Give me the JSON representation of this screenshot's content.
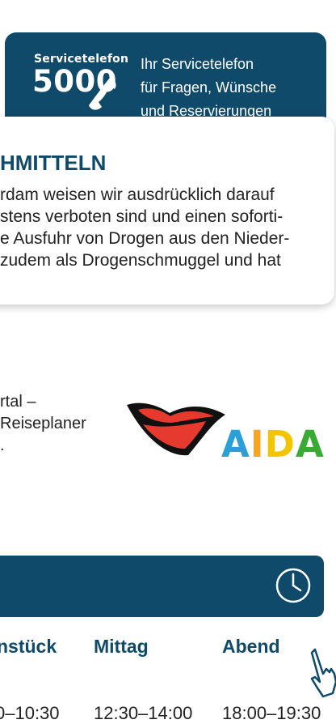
{
  "service_banner": {
    "label": "Servicetelefon",
    "number": "5000",
    "text_lines": [
      "Ihr Servicetelefon",
      "für Fragen, Wünsche",
      "und Reservierungen"
    ]
  },
  "notice": {
    "title": "HMITTELN",
    "lines": [
      "rdam weisen wir ausdrücklich darauf",
      "stens verboten sind und einen soforti-",
      "e Ausfuhr von Drogen aus den Nieder-",
      "zudem als Drogenschmuggel und hat"
    ]
  },
  "portal": {
    "lines": [
      "rtal –",
      "Reiseplaner",
      "."
    ]
  },
  "aida": {
    "letters": [
      "A",
      "I",
      "D",
      "A"
    ],
    "colors": [
      "#2a9fd8",
      "#f5a623",
      "#f2c500",
      "#3aaa35"
    ]
  },
  "meals": {
    "headings": [
      "nstück",
      "Mittag",
      "Abend"
    ],
    "times": [
      "0–10:30",
      "12:30–14:00",
      "18:00–19:30"
    ]
  },
  "colors": {
    "brand_blue": "#0f4a6b",
    "lips_red": "#e63a2e"
  }
}
